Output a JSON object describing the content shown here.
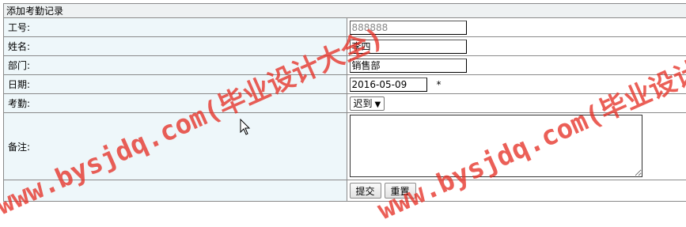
{
  "form": {
    "title": "添加考勤记录",
    "fields": {
      "employee_id": {
        "label": "工号:",
        "value": "888888"
      },
      "name": {
        "label": "姓名:",
        "value": "李四"
      },
      "department": {
        "label": "部门:",
        "value": "销售部"
      },
      "date": {
        "label": "日期:",
        "value": "2016-05-09",
        "required_mark": "*"
      },
      "attendance": {
        "label": "考勤:",
        "selected": "迟到"
      },
      "remark": {
        "label": "备注:",
        "value": ""
      }
    },
    "buttons": {
      "submit": "提交",
      "reset": "重置"
    }
  },
  "watermark": {
    "text_1": "www.bysjdq.com(毕业设计大全)",
    "text_2": "www.bysjdq.com(毕业设计大全)"
  },
  "icons": [
    "dropdown-arrow-icon",
    "mouse-cursor-icon"
  ],
  "colors": {
    "label_bg": "#eef7fa",
    "title_bg": "#eef1f2",
    "border": "#8a8a8a",
    "watermark": "#e63228"
  }
}
